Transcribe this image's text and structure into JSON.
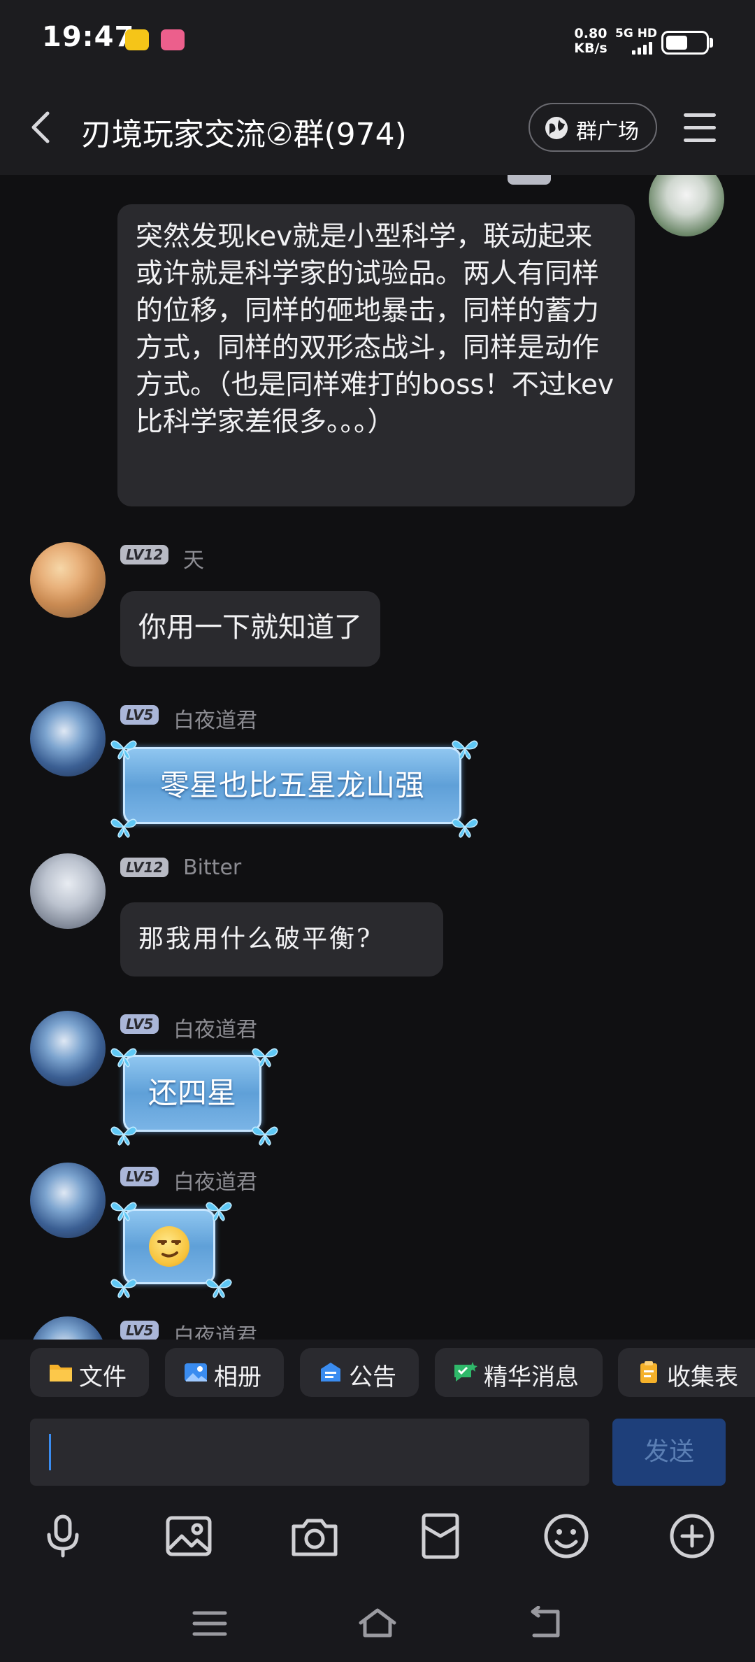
{
  "status_bar": {
    "time": "19:47",
    "net_speed_value": "0.80",
    "net_speed_unit": "KB/s",
    "net_type": "5G HD",
    "battery_level": 0.55,
    "notification_icons": [
      "app-notification-icon-yellow",
      "app-notification-icon-pink"
    ]
  },
  "header": {
    "title": "刃境玩家交流②群(974)",
    "plaza_label": "群广场",
    "back_icon": "chevron-left-icon",
    "menu_icon": "hamburger-menu-icon"
  },
  "messages": {
    "m0": {
      "text": "突然发现kev就是小型科学，联动起来或许就是科学家的试验品。两人有同样的位移，同样的砸地暴击，同样的蓄力方式，同样的双形态战斗，同样是动作方式。（也是同样难打的boss！不过kev比科学家差很多。。。）"
    },
    "m1": {
      "level": "LV12",
      "name": "天",
      "text": "你用一下就知道了"
    },
    "m2": {
      "level": "LV5",
      "name": "白夜道君",
      "text": "零星也比五星龙山强"
    },
    "m3": {
      "level": "LV12",
      "name": "Bitter",
      "text": "那我用什么破平衡?"
    },
    "m4": {
      "level": "LV5",
      "name": "白夜道君",
      "text": "还四星"
    },
    "m5": {
      "level": "LV5",
      "name": "白夜道君",
      "emoji": "smirk-emoji"
    },
    "m6": {
      "level": "LV5",
      "name": "白夜道君"
    }
  },
  "quick_actions": {
    "file": "文件",
    "album": "相册",
    "notice": "公告",
    "featured": "精华消息",
    "form": "收集表"
  },
  "input": {
    "value": "",
    "send_label": "发送"
  },
  "toolbar_icons": [
    "microphone-icon",
    "image-icon",
    "camera-icon",
    "red-packet-icon",
    "emoji-icon",
    "plus-icon"
  ],
  "colors": {
    "accent": "#3a8cf0",
    "send_button": "#1e3f7a",
    "bubble": "#2a2a2e",
    "background": "#101012"
  }
}
